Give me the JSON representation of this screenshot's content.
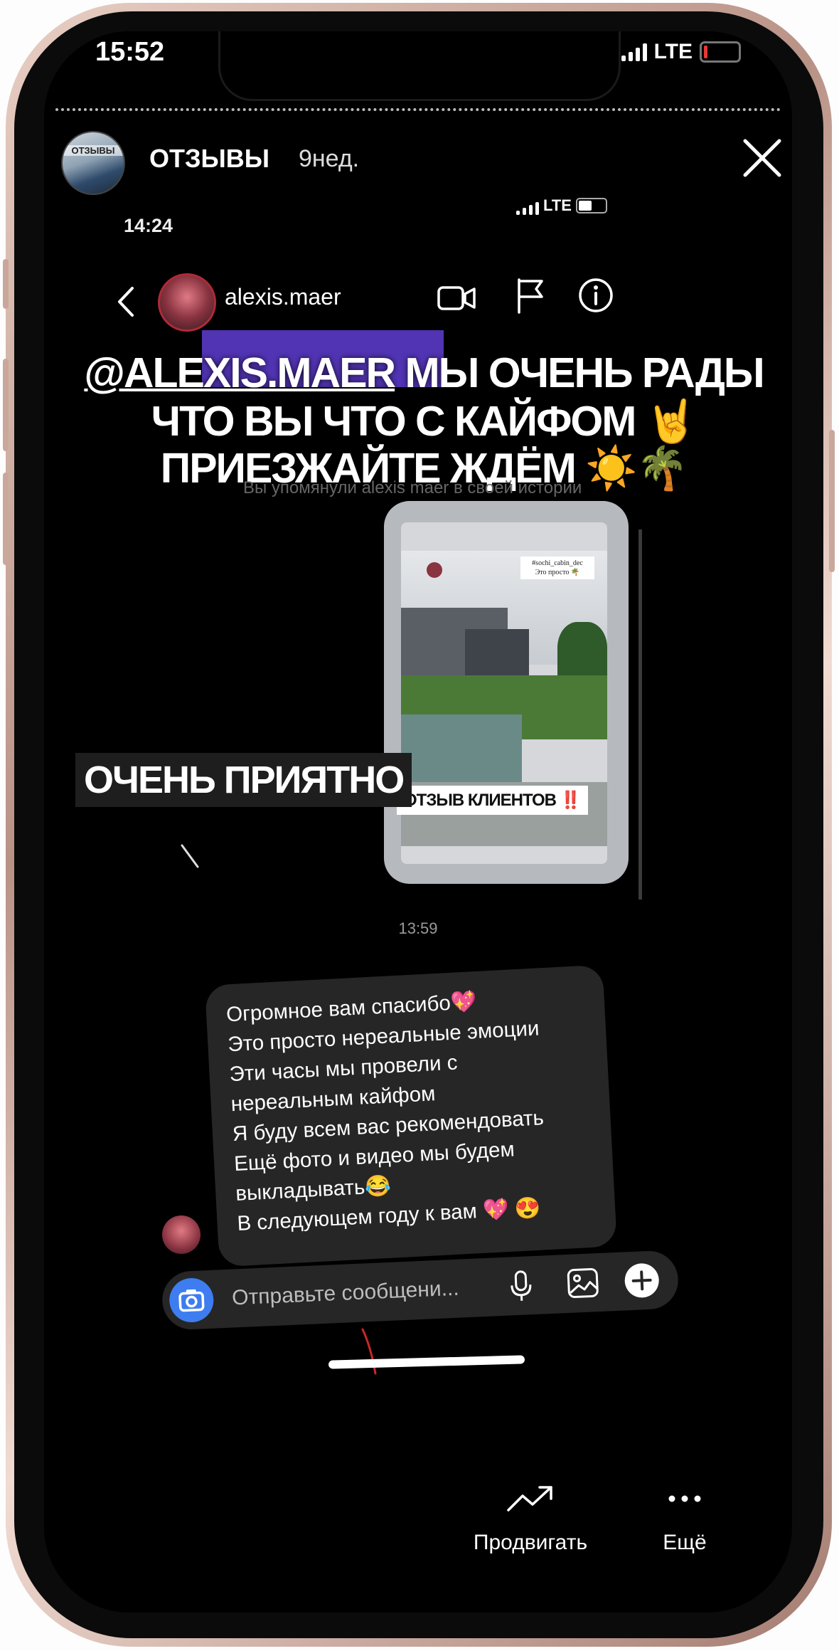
{
  "status_bar": {
    "time": "15:52",
    "network": "LTE"
  },
  "story_header": {
    "avatar_text": "ОТЗЫВЫ",
    "username": "ОТЗЫВЫ",
    "time_ago": "9нед."
  },
  "screenshot": {
    "status_time": "14:24",
    "status_network": "LTE",
    "chat_username": "alexis.maer"
  },
  "caption": {
    "mention": "@ALEXIS.MAER",
    "line1_rest": " МЫ ОЧЕНЬ РАДЫ",
    "line2": "ЧТО ВЫ  ЧТО С КАЙФОМ 🤘",
    "line3": "ПРИЕЗЖАЙТЕ ЖДЁМ ☀️🌴",
    "ghost_text": "Вы упомянули alexis maer в своей истории"
  },
  "shared_story": {
    "sticker_line1": "#sochi_cabin_dec",
    "sticker_line2": "Это просто 🌴",
    "label": "ОТЗЫВ КЛИЕНТОВ ‼️"
  },
  "overlay_caption": "ОЧЕНЬ ПРИЯТНО",
  "message": {
    "time": "13:59",
    "lines": [
      "Огромное вам спасибо💖",
      "Это просто нереальные эмоции",
      "Эти часы мы провели с",
      "нереальным кайфом",
      "Я буду всем вас рекомендовать",
      "Ещё фото и видео мы будем",
      "выкладывать😂",
      "В следующем году к вам 💖 😍"
    ]
  },
  "composer": {
    "placeholder": "Отправьте сообщени..."
  },
  "bottom_actions": {
    "promote_label": "Продвигать",
    "more_label": "Ещё"
  }
}
